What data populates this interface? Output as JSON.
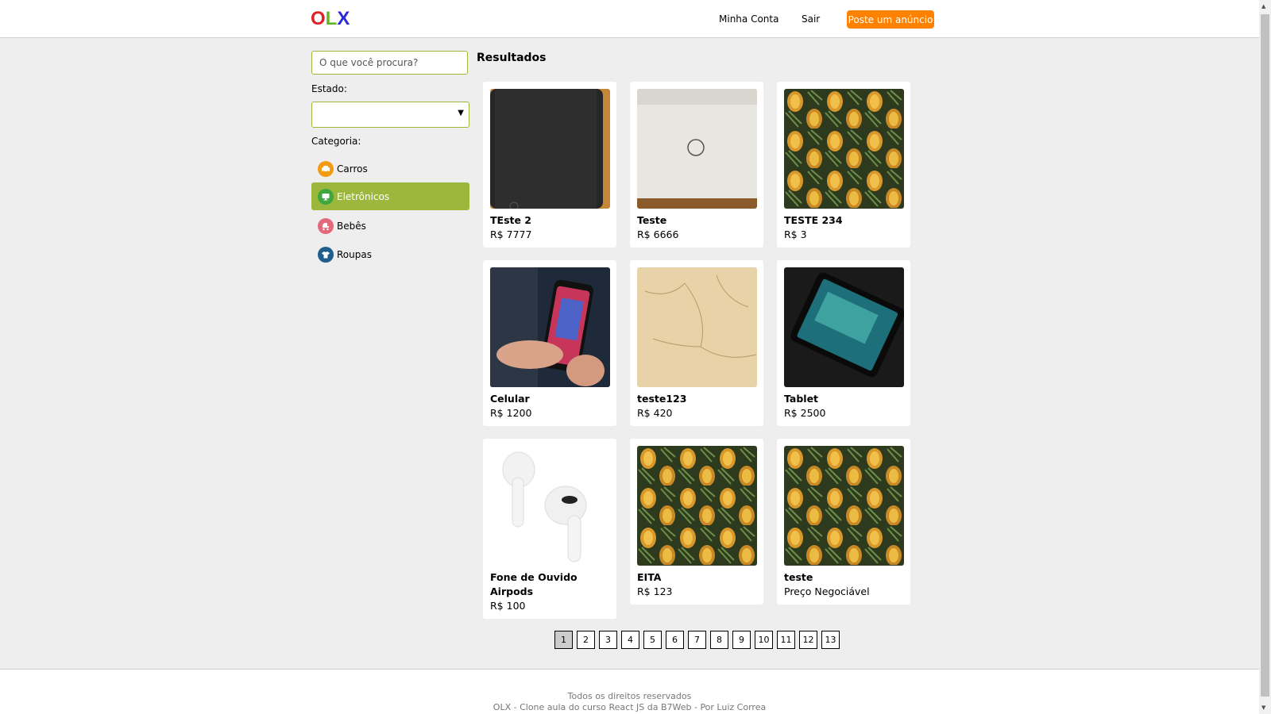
{
  "header": {
    "logo": {
      "o": "O",
      "l": "L",
      "x": "X"
    },
    "my_account": "Minha Conta",
    "logout": "Sair",
    "post_ad": "Poste um anúncio"
  },
  "sidebar": {
    "search_placeholder": "O que você procura?",
    "state_label": "Estado:",
    "state_value": "",
    "category_label": "Categoria:",
    "categories": [
      {
        "label": "Carros",
        "icon": "car-icon",
        "color": "#f39c12"
      },
      {
        "label": "Eletrônicos",
        "icon": "monitor-icon",
        "color": "#3fa63f"
      },
      {
        "label": "Bebês",
        "icon": "stroller-icon",
        "color": "#e26a7a"
      },
      {
        "label": "Roupas",
        "icon": "shirt-icon",
        "color": "#1f5d8c"
      }
    ]
  },
  "main": {
    "title": "Resultados",
    "products": [
      {
        "title": "TEste 2",
        "price": "R$ 7777",
        "image": "speaker"
      },
      {
        "title": "Teste",
        "price": "R$ 6666",
        "image": "laptop"
      },
      {
        "title": "TESTE 234",
        "price": "R$ 3",
        "image": "pineapples"
      },
      {
        "title": "Celular",
        "price": "R$ 1200",
        "image": "phone"
      },
      {
        "title": "teste123",
        "price": "R$ 420",
        "image": "sand"
      },
      {
        "title": "Tablet",
        "price": "R$ 2500",
        "image": "tablet"
      },
      {
        "title": "Fone de Ouvido Airpods",
        "price": "R$ 100",
        "image": "airpods"
      },
      {
        "title": "EITA",
        "price": "R$ 123",
        "image": "pineapples"
      },
      {
        "title": "teste",
        "price": "Preço Negociável",
        "image": "pineapples"
      }
    ]
  },
  "pagination": {
    "pages": [
      "1",
      "2",
      "3",
      "4",
      "5",
      "6",
      "7",
      "8",
      "9",
      "10",
      "11",
      "12",
      "13"
    ],
    "current": "1"
  },
  "footer": {
    "line1": "Todos os direitos reservados",
    "line2": "OLX - Clone aula do curso React JS da B7Web - Por Luiz Correa"
  },
  "colors": {
    "accent": "#9bb83d",
    "post_button": "#ff8100"
  }
}
